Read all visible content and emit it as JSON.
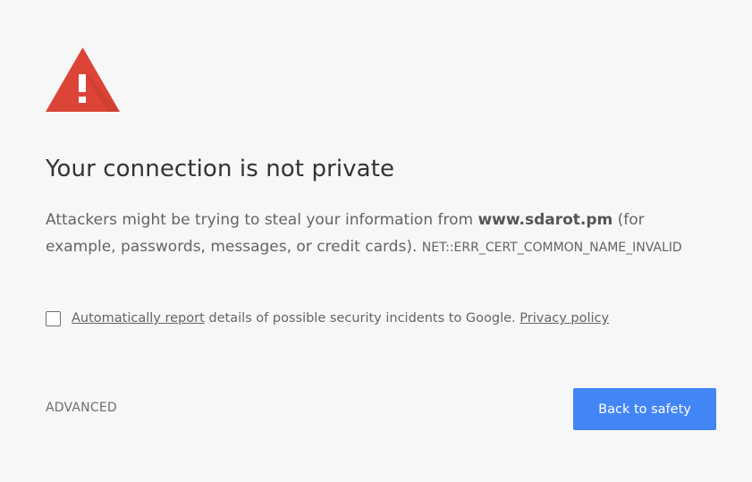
{
  "interstitial": {
    "title": "Your connection is not private",
    "explanation_before": "Attackers might be trying to steal your information from ",
    "hostname": "www.sdarot.pm",
    "explanation_after": " (for example, passwords, messages, or credit cards). ",
    "error_code": "NET::ERR_CERT_COMMON_NAME_INVALID",
    "icon": "warning-triangle-icon",
    "icon_color": "#db4437"
  },
  "report": {
    "checked": false,
    "link_label": "Automatically report",
    "text": " details of possible security incidents to Google. ",
    "privacy_link_label": "Privacy policy"
  },
  "buttons": {
    "advanced_label": "ADVANCED",
    "primary_label": "Back to safety",
    "primary_color": "#4285f4"
  },
  "colors": {
    "background": "#f7f7f7"
  }
}
